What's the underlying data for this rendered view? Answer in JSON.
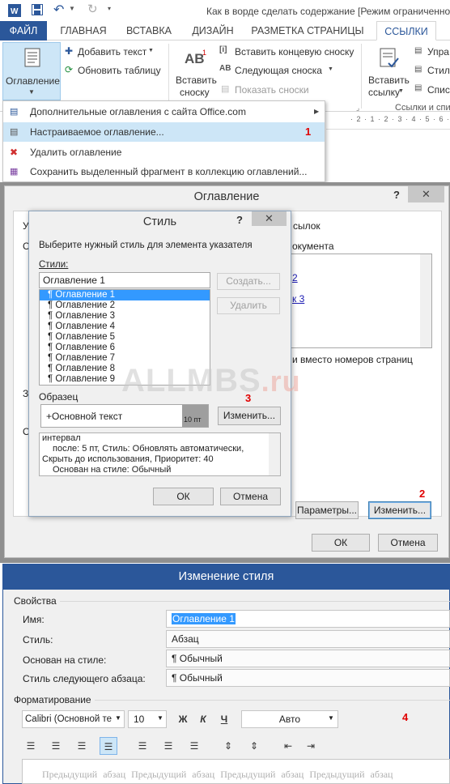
{
  "titlebar": {
    "title": "Как в ворде сделать содержание [Режим ограниченной"
  },
  "tabs": [
    "ФАЙЛ",
    "ГЛАВНАЯ",
    "ВСТАВКА",
    "ДИЗАЙН",
    "РАЗМЕТКА СТРАНИЦЫ",
    "ССЫЛКИ"
  ],
  "ribbon": {
    "toc_label": "Оглавление",
    "add_text": "Добавить текст",
    "update_table": "Обновить таблицу",
    "insert_footnote_1": "Вставить",
    "insert_footnote_2": "сноску",
    "insert_endnote": "Вставить концевую сноску",
    "next_footnote": "Следующая сноска",
    "show_notes": "Показать сноски",
    "insert_citation_1": "Вставить",
    "insert_citation_2": "ссылку",
    "manage": "Упра",
    "style": "Стил",
    "list": "Спис",
    "group_label": "Ссылки и спи",
    "ab_text": "AB",
    "ruler": "· 2 · 1 · 2 · 3 · 4 · 5 · 6 ·"
  },
  "menu": {
    "items": [
      "Дополнительные оглавления с сайта Office.com",
      "Настраиваемое оглавление...",
      "Удалить оглавление",
      "Сохранить выделенный фрагмент в коллекцию оглавлений..."
    ],
    "marker1": "1"
  },
  "toc_dialog": {
    "title": "Оглавление",
    "help": "?",
    "close": "✕",
    "tab_y": "У",
    "tab_links": "сылок",
    "doc_text": "окумента",
    "link1": "2",
    "link2": "к 3",
    "hyperlinks_text": "и вместо номеров страниц",
    "z": "З",
    "o": "О",
    "params": "Параметры...",
    "modify": "Изменить...",
    "ok": "ОК",
    "cancel": "Отмена",
    "marker2": "2"
  },
  "style_dialog": {
    "title": "Стиль",
    "help": "?",
    "close": "✕",
    "prompt": "Выберите нужный стиль для элемента указателя",
    "styles_label": "Стили:",
    "styles_value": "Оглавление 1",
    "create": "Создать...",
    "delete": "Удалить",
    "items": [
      "Оглавление 1",
      "Оглавление 2",
      "Оглавление 3",
      "Оглавление 4",
      "Оглавление 5",
      "Оглавление 6",
      "Оглавление 7",
      "Оглавление 8",
      "Оглавление 9"
    ],
    "sample_label": "Образец",
    "sample_text": "+Основной текст",
    "sample_size": "10 пт",
    "modify": "Изменить...",
    "marker3": "3",
    "desc": [
      "интервал",
      "после: 5 пт, Стиль: Обновлять автоматически,",
      "Скрыть до использования, Приоритет: 40",
      "Основан на стиле: Обычный"
    ],
    "ok": "ОК",
    "cancel": "Отмена"
  },
  "watermark": {
    "text1": "ALLMBS",
    "text2": ".ru"
  },
  "modify_dialog": {
    "title": "Изменение стиля",
    "props": "Свойства",
    "name_label": "Имя:",
    "name_value": "Оглавление 1",
    "style_label": "Стиль:",
    "style_value": "Абзац",
    "based_label": "Основан на стиле:",
    "based_value": "¶ Обычный",
    "next_label": "Стиль следующего абзаца:",
    "next_value": "¶ Обычный",
    "formatting": "Форматирование",
    "font": "Calibri (Основной те",
    "size": "10",
    "bold": "Ж",
    "italic": "К",
    "underline": "Ч",
    "color": "Авто",
    "marker4": "4",
    "preview": "Предыдущий абзац Предыдущий абзац Предыдущий абзац Предыдущий абзац"
  },
  "colors": {
    "accent": "#2b579a",
    "highlight": "#cde6f7",
    "red": "#e00000"
  }
}
